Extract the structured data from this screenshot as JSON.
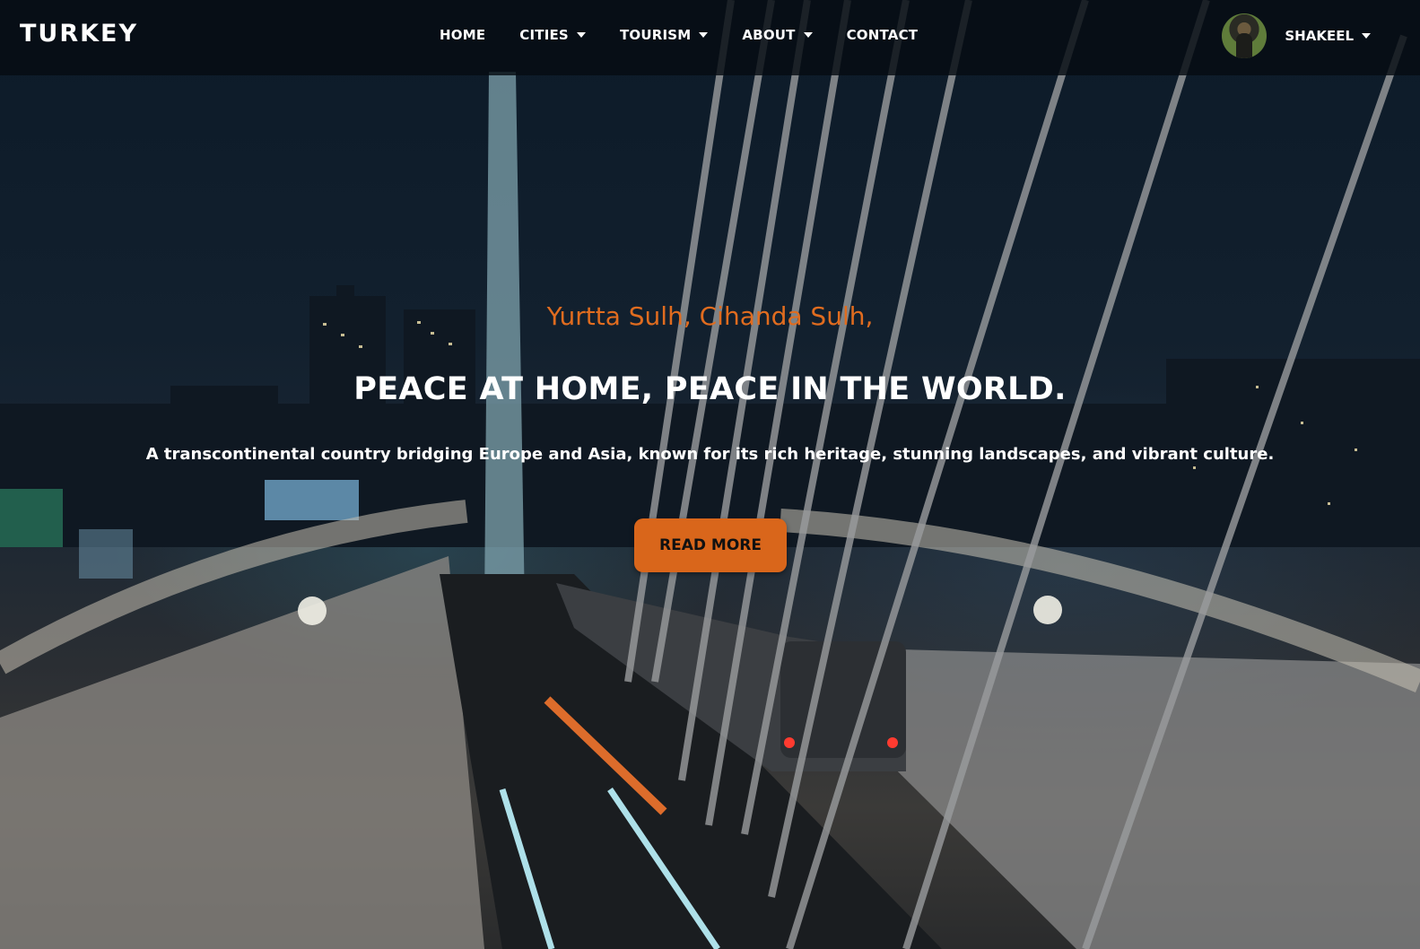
{
  "brand": {
    "name": "TURKEY"
  },
  "nav": {
    "items": [
      {
        "label": "HOME",
        "dropdown": false
      },
      {
        "label": "CITIES",
        "dropdown": true
      },
      {
        "label": "TOURISM",
        "dropdown": true
      },
      {
        "label": "ABOUT",
        "dropdown": true
      },
      {
        "label": "CONTACT",
        "dropdown": false
      }
    ]
  },
  "user": {
    "name": "SHAKEEL"
  },
  "hero": {
    "tagline": "Yurtta Sulh, Cihanda Sulh,",
    "headline": "PEACE AT HOME, PEACE IN THE WORLD.",
    "description": "A transcontinental country bridging Europe and Asia, known for its rich heritage, stunning landscapes, and vibrant culture.",
    "cta_label": "READ MORE"
  },
  "colors": {
    "accent": "#d9661b",
    "tagline": "#e06c1f",
    "navbar": "#060c12"
  }
}
